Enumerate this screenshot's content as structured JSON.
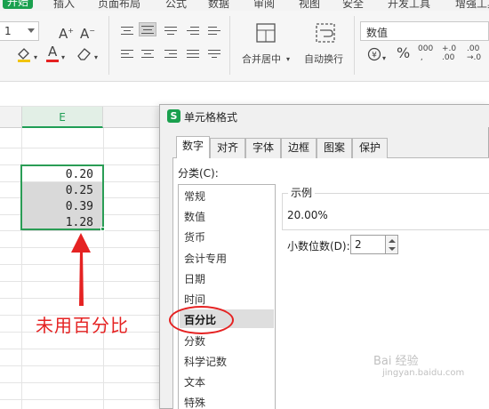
{
  "ribbon": {
    "menu": [
      "开始",
      "插入",
      "页面布局",
      "公式",
      "数据",
      "审阅",
      "视图",
      "安全",
      "开发工具",
      "增强工具"
    ],
    "font_size_fragment": "1",
    "increase_font_icon": "A⁺",
    "decrease_font_icon": "A⁻",
    "fill_color_hex": "#f1c40f",
    "font_color_hex": "#e52222",
    "merge_label": "合并居中",
    "wrap_label": "自动换行",
    "number_format": "数值",
    "percent_symbol": "%",
    "thousands_symbol": "000",
    "inc_decimal": "+.0\n.00",
    "dec_decimal": ".00\n→.0"
  },
  "sheet": {
    "column_header": "E",
    "values": [
      "0.20",
      "0.25",
      "0.39",
      "1.28"
    ],
    "annotation": "未用百分比"
  },
  "dialog": {
    "title": "单元格格式",
    "logo": "S",
    "tabs": [
      "数字",
      "对齐",
      "字体",
      "边框",
      "图案",
      "保护"
    ],
    "active_tab": "数字",
    "category_label": "分类(C):",
    "categories": [
      "常规",
      "数值",
      "货币",
      "会计专用",
      "日期",
      "时间",
      "百分比",
      "分数",
      "科学记数",
      "文本",
      "特殊"
    ],
    "selected_category": "百分比",
    "sample_label": "示例",
    "sample_value": "20.00%",
    "decimal_label": "小数位数(D):",
    "decimal_value": "2"
  },
  "watermark": {
    "text": "Bai 经验",
    "sub": "jingyan.baidu.com"
  }
}
